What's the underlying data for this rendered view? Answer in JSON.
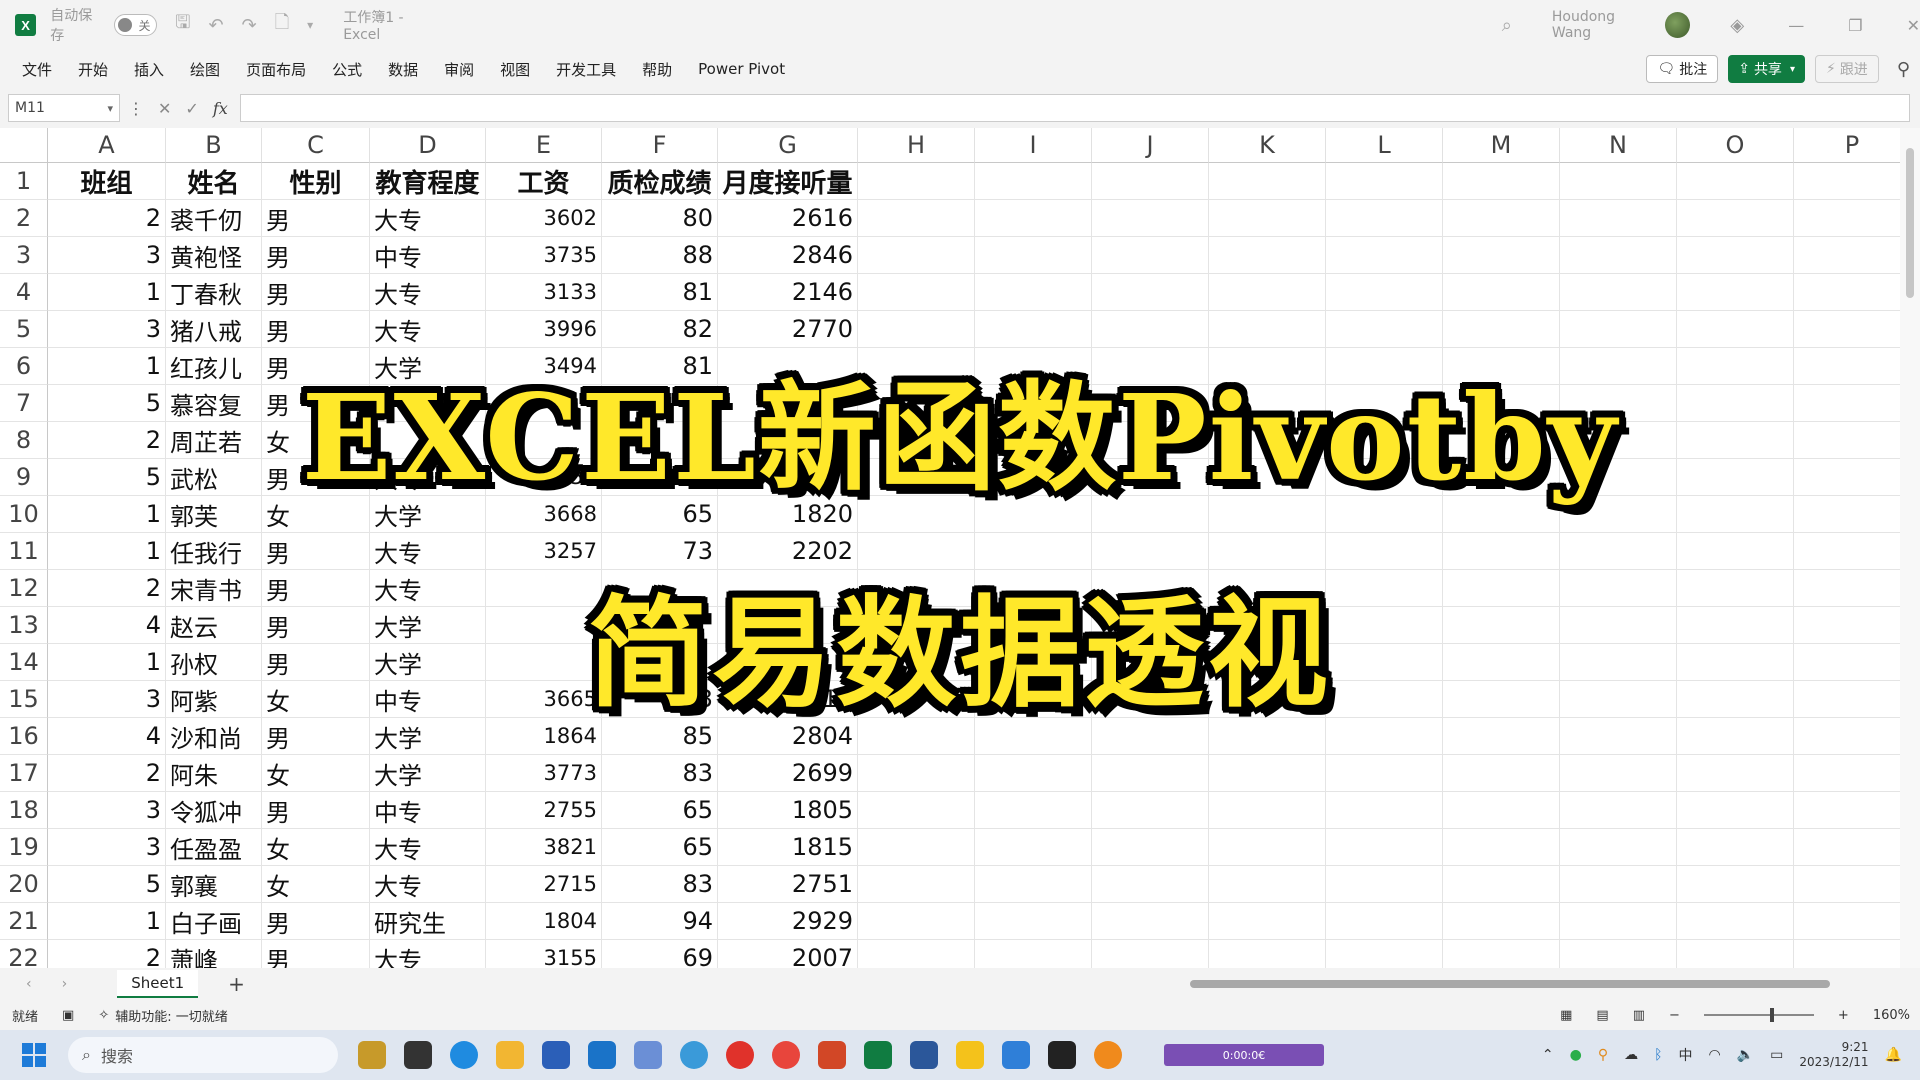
{
  "titlebar": {
    "app_icon": "X",
    "autosave_label": "自动保存",
    "autosave_state": "关",
    "document_title": "工作簿1 - Excel",
    "user_name": "Houdong Wang"
  },
  "menu": {
    "items": [
      "文件",
      "开始",
      "插入",
      "绘图",
      "页面布局",
      "公式",
      "数据",
      "审阅",
      "视图",
      "开发工具",
      "帮助",
      "Power Pivot"
    ],
    "comment_label": "批注",
    "share_label": "共享",
    "follow_label": "跟进"
  },
  "formula_bar": {
    "name_box": "M11",
    "fx_label": "fx",
    "formula": ""
  },
  "grid": {
    "columns": [
      "A",
      "B",
      "C",
      "D",
      "E",
      "F",
      "G",
      "H",
      "I",
      "J",
      "K",
      "L",
      "M",
      "N",
      "O",
      "P"
    ],
    "headers": [
      "班组",
      "姓名",
      "性别",
      "教育程度",
      "工资",
      "质检成绩",
      "月度接听量"
    ],
    "rows": [
      [
        "2",
        "裘千仞",
        "男",
        "大专",
        "3602",
        "80",
        "2616"
      ],
      [
        "3",
        "黄袍怪",
        "男",
        "中专",
        "3735",
        "88",
        "2846"
      ],
      [
        "1",
        "丁春秋",
        "男",
        "大专",
        "3133",
        "81",
        "2146"
      ],
      [
        "3",
        "猪八戒",
        "男",
        "大专",
        "3996",
        "82",
        "2770"
      ],
      [
        "1",
        "红孩儿",
        "男",
        "大学",
        "3494",
        "81",
        ""
      ],
      [
        "5",
        "慕容复",
        "男",
        "",
        "",
        "",
        ""
      ],
      [
        "2",
        "周芷若",
        "女",
        "",
        "",
        "",
        ""
      ],
      [
        "5",
        "武松",
        "男",
        "大专",
        "3856",
        "96",
        ""
      ],
      [
        "1",
        "郭芙",
        "女",
        "大学",
        "3668",
        "65",
        "1820"
      ],
      [
        "1",
        "任我行",
        "男",
        "大专",
        "3257",
        "73",
        "2202"
      ],
      [
        "2",
        "宋青书",
        "男",
        "大专",
        "",
        "",
        ""
      ],
      [
        "4",
        "赵云",
        "男",
        "大学",
        "",
        "",
        ""
      ],
      [
        "1",
        "孙权",
        "男",
        "大学",
        "",
        "",
        ""
      ],
      [
        "3",
        "阿紫",
        "女",
        "中专",
        "3665",
        "83",
        "2710"
      ],
      [
        "4",
        "沙和尚",
        "男",
        "大学",
        "1864",
        "85",
        "2804"
      ],
      [
        "2",
        "阿朱",
        "女",
        "大学",
        "3773",
        "83",
        "2699"
      ],
      [
        "3",
        "令狐冲",
        "男",
        "中专",
        "2755",
        "65",
        "1805"
      ],
      [
        "3",
        "任盈盈",
        "女",
        "大专",
        "3821",
        "65",
        "1815"
      ],
      [
        "5",
        "郭襄",
        "女",
        "大专",
        "2715",
        "83",
        "2751"
      ],
      [
        "1",
        "白子画",
        "男",
        "研究生",
        "1804",
        "94",
        "2929"
      ],
      [
        "2",
        "萧峰",
        "男",
        "大专",
        "3155",
        "69",
        "2007"
      ]
    ]
  },
  "sheet_tabs": {
    "active": "Sheet1",
    "add_label": "+"
  },
  "status": {
    "ready": "就绪",
    "accessibility": "辅助功能: 一切就绪",
    "zoom": "160%"
  },
  "taskbar": {
    "search_placeholder": "搜索",
    "media_time": "0:00:0€",
    "ime": "中",
    "time": "9:21",
    "date": "2023/12/11"
  },
  "overlay": {
    "line1": "EXCEL新函数Pivotby",
    "line2": "简易数据透视"
  },
  "colors": {
    "excel_green": "#107c41",
    "caption_yellow": "#ffe82a",
    "caption_outline": "#000000"
  }
}
